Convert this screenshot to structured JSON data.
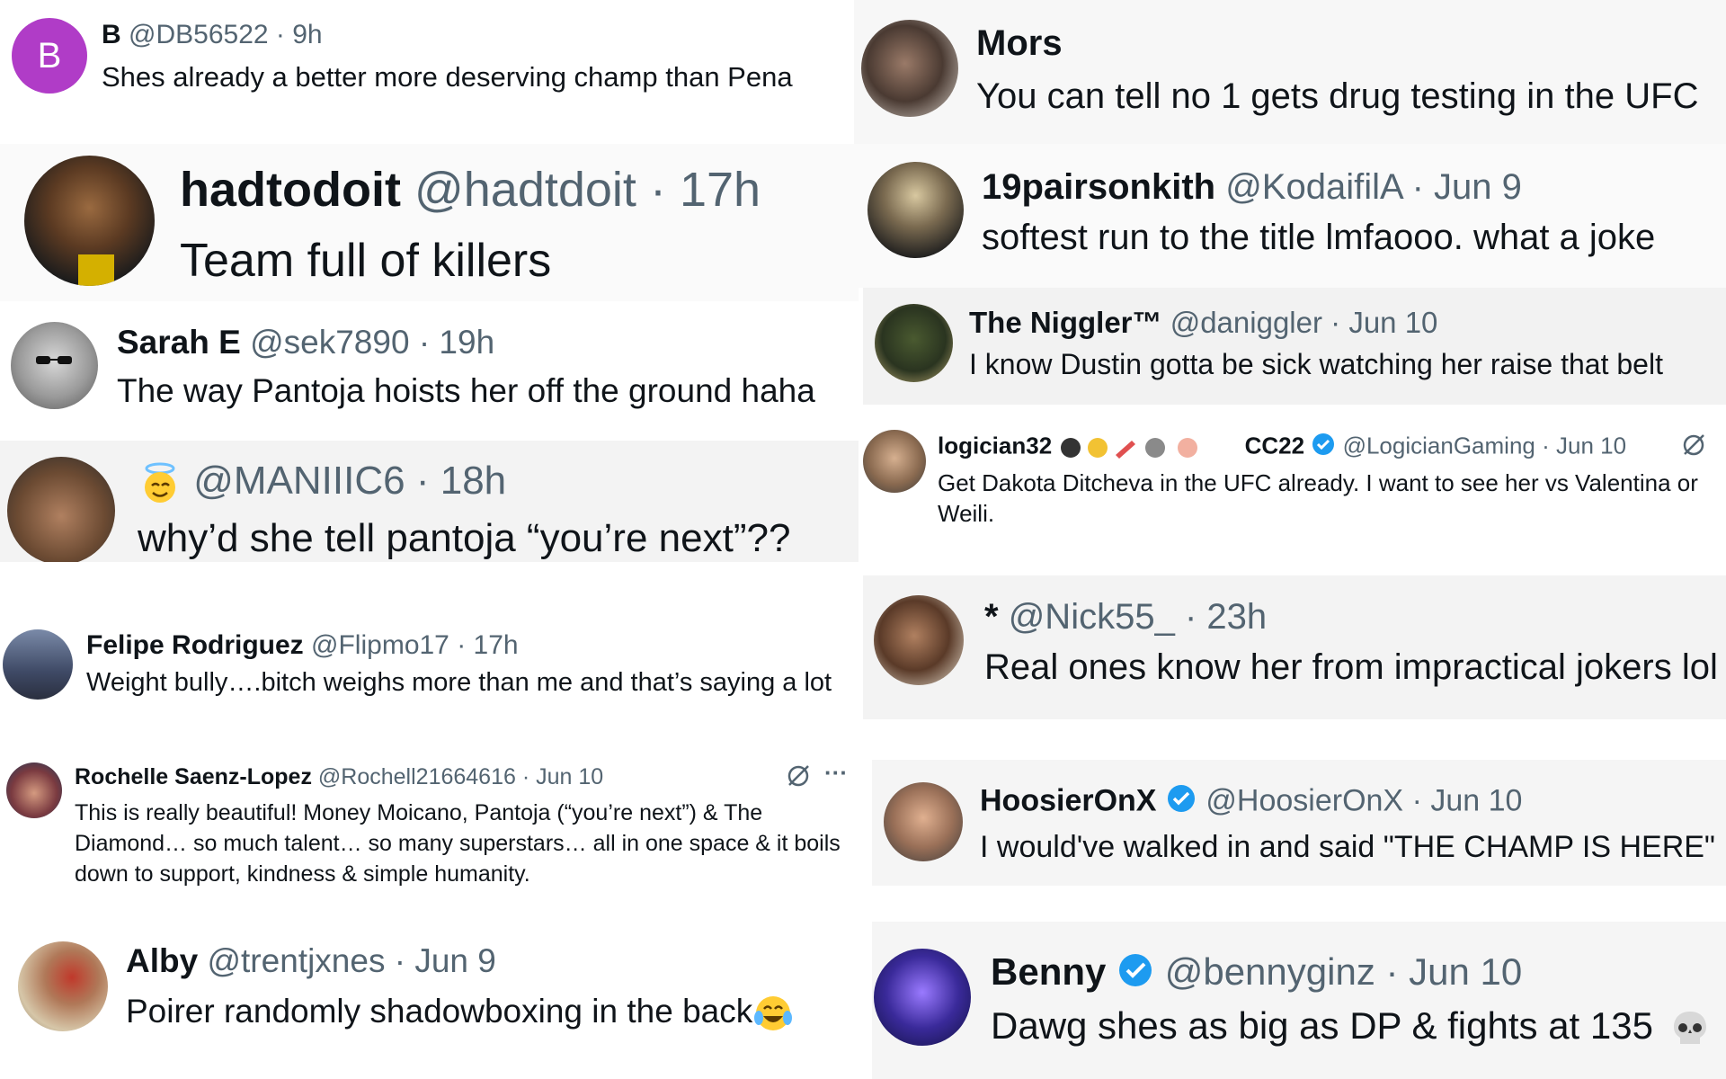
{
  "tweets": [
    {
      "name": "B",
      "handle": "@DB56522",
      "time": "· 9h",
      "text": "Shes already a better more deserving champ than Pena",
      "avatar_letter": "B",
      "avatar_color": "#b03cc7"
    },
    {
      "name": "hadtodoit",
      "handle": "@hadtdoit",
      "time": "· 17h",
      "text": "Team full of killers"
    },
    {
      "name": "Sarah E",
      "handle": "@sek7890",
      "time": "· 19h",
      "text": "The way Pantoja hoists her off the ground haha"
    },
    {
      "name": "",
      "handle": "@MANIIIC6",
      "time": "· 18h",
      "text": "why’d she tell pantoja “you’re next”??",
      "name_icon": "angel-face-emoji"
    },
    {
      "name": "Felipe Rodriguez",
      "handle": "@Flipmo17",
      "time": "· 17h",
      "text": "Weight bully….bitch weighs more than me and that’s saying a lot"
    },
    {
      "name": "Rochelle Saenz-Lopez",
      "handle": "@Rochell21664616",
      "time": "· Jun 10",
      "text": "This is really beautiful! Money Moicano, Pantoja (“you’re next”) & The Diamond… so much talent… so many superstars… all in one space & it boils down to support, kindness & simple humanity.",
      "more": "···"
    },
    {
      "name": "Alby",
      "handle": "@trentjxnes",
      "time": "· Jun 9",
      "text": "Poirer randomly shadowboxing in the back",
      "trailing_icon": "tears-of-joy-emoji"
    },
    {
      "name": "Mors",
      "handle": "",
      "time": "",
      "text": "You can tell no 1 gets drug testing in the UFC"
    },
    {
      "name": "19pairsonkith",
      "handle": "@KodaifilA",
      "time": "· Jun 9",
      "text": "softest run to the title lmfaooo. what a joke"
    },
    {
      "name": "The Niggler™",
      "handle": "@daniggler",
      "time": "· Jun 10",
      "text": "I know Dustin gotta be sick watching her raise that belt"
    },
    {
      "name": "logician32",
      "name_suffix": "CC22",
      "handle": "@LogicianGaming",
      "time": "· Jun 10",
      "text": "Get Dakota Ditcheva in the UFC already. I want to see her vs Valentina or Weili.",
      "verified": true
    },
    {
      "name": "*",
      "handle": "@Nick55_",
      "time": "· 23h",
      "text": "Real ones know her from impractical jokers lol"
    },
    {
      "name": "HoosierOnX",
      "handle": "@HoosierOnX",
      "time": "· Jun 10",
      "text": "I would've walked in and said \"THE CHAMP IS HERE\"",
      "verified": true
    },
    {
      "name": "Benny",
      "handle": "@bennyginz",
      "time": "· Jun 10",
      "text": "Dawg shes as big as DP & fights at 135",
      "verified": true,
      "trailing_icon": "skull-emoji"
    }
  ],
  "colors": {
    "verified": "#1d9bf0",
    "meta": "#536471",
    "tile_gray": "#f7f7f7"
  }
}
